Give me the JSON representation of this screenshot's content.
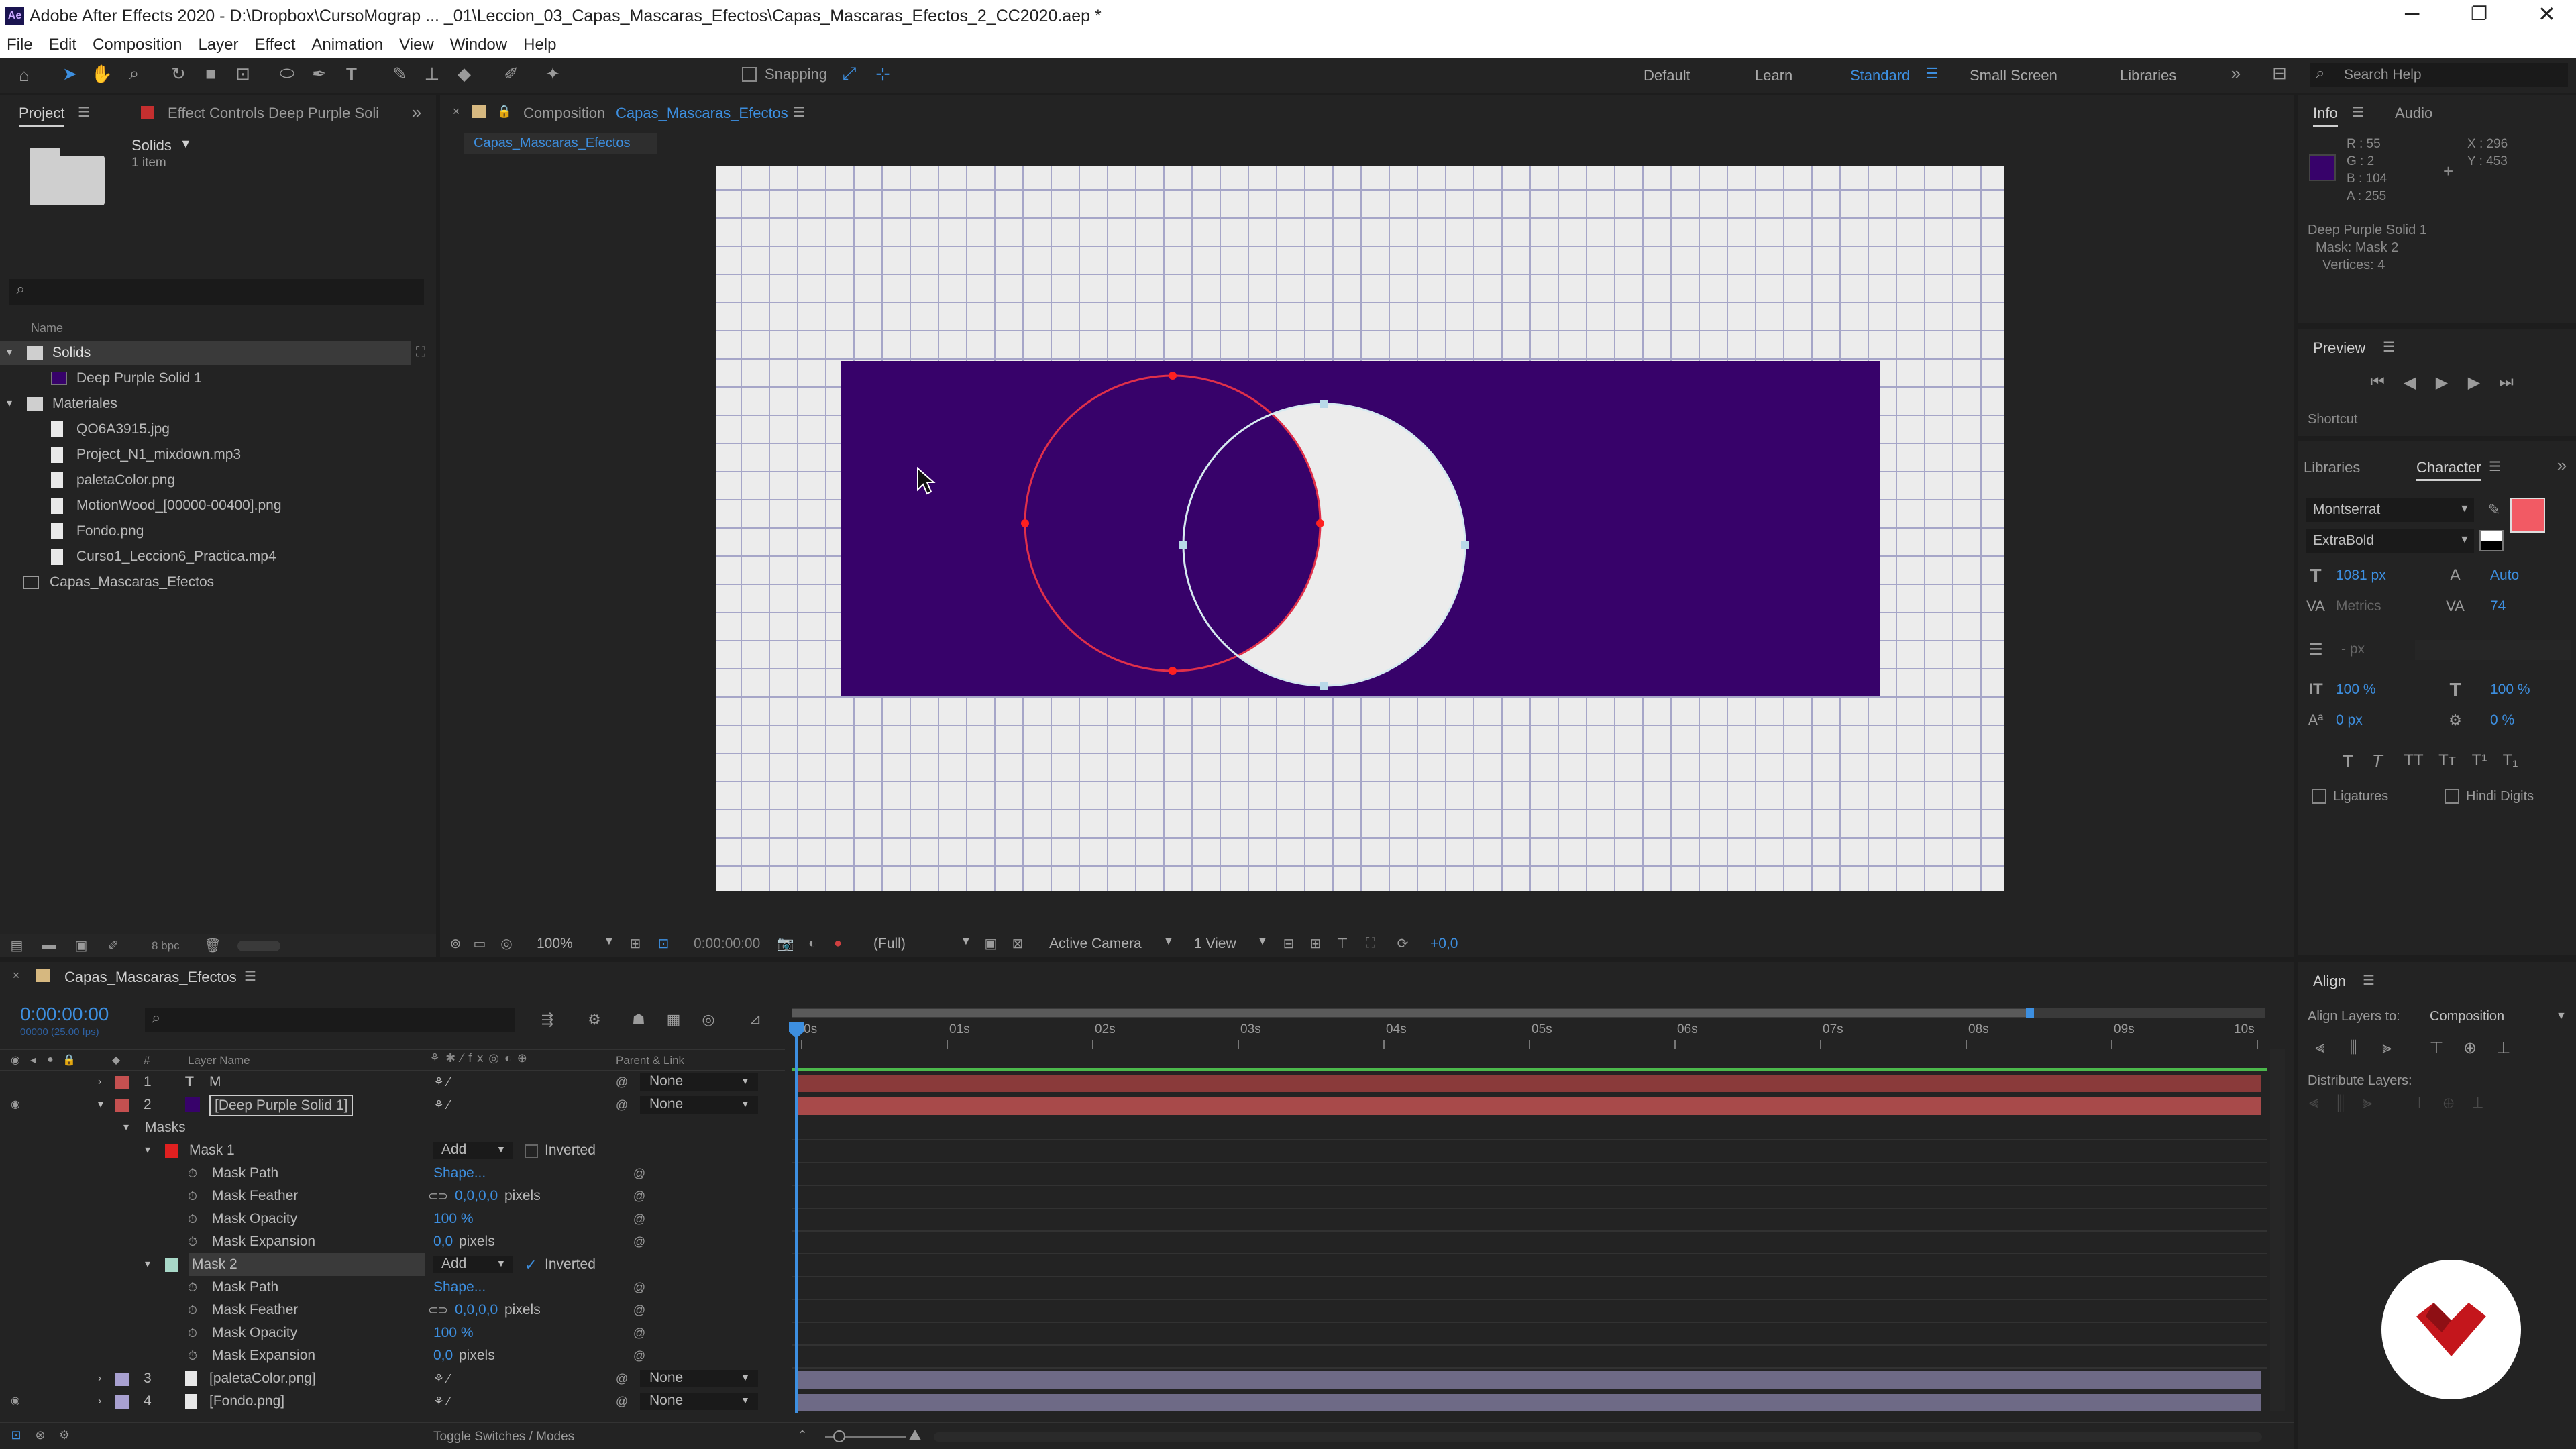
{
  "app": {
    "title": "Adobe After Effects 2020 - D:\\Dropbox\\CursoMograp ... _01\\Leccion_03_Capas_Mascaras_Efectos\\Capas_Mascaras_Efectos_2_CC2020.aep *"
  },
  "menu": [
    "File",
    "Edit",
    "Composition",
    "Layer",
    "Effect",
    "Animation",
    "View",
    "Window",
    "Help"
  ],
  "toolbar": {
    "snapping": "Snapping"
  },
  "workspaces": [
    "Default",
    "Learn",
    "Standard",
    "Small Screen",
    "Libraries"
  ],
  "search_help": "Search Help",
  "project": {
    "tab": "Project",
    "effect_controls_tab": "Effect Controls Deep Purple Soli",
    "selected_name": "Solids",
    "selected_count": "1 item",
    "column_name": "Name",
    "items": [
      {
        "label": "Solids",
        "type": "folder",
        "level": 0
      },
      {
        "label": "Deep Purple Solid 1",
        "type": "solid",
        "level": 1
      },
      {
        "label": "Materiales",
        "type": "folder",
        "level": 0
      },
      {
        "label": "QO6A3915.jpg",
        "type": "file",
        "level": 1
      },
      {
        "label": "Project_N1_mixdown.mp3",
        "type": "file",
        "level": 1
      },
      {
        "label": "paletaColor.png",
        "type": "file",
        "level": 1
      },
      {
        "label": "MotionWood_[00000-00400].png",
        "type": "file",
        "level": 1
      },
      {
        "label": "Fondo.png",
        "type": "file",
        "level": 1
      },
      {
        "label": "Curso1_Leccion6_Practica.mp4",
        "type": "file",
        "level": 1
      },
      {
        "label": "Capas_Mascaras_Efectos",
        "type": "comp",
        "level": 0
      }
    ],
    "bpc": "8 bpc"
  },
  "composition": {
    "tab_prefix": "Composition",
    "tab_name": "Capas_Mascaras_Efectos",
    "subtab": "Capas_Mascaras_Efectos",
    "zoom": "100%",
    "timecode": "0:00:00:00",
    "resolution": "(Full)",
    "camera": "Active Camera",
    "views": "1 View",
    "exposure": "+0,0"
  },
  "info": {
    "tab": "Info",
    "audio_tab": "Audio",
    "r": "R : 55",
    "g": "G : 2",
    "b": "B : 104",
    "a": "A : 255",
    "x": "X : 296",
    "y": "Y : 453",
    "layer": "Deep Purple Solid 1",
    "mask": "Mask: Mask 2",
    "vertices": "Vertices: 4",
    "swatch": "#37026a"
  },
  "preview": {
    "tab": "Preview",
    "shortcut": "Shortcut"
  },
  "character": {
    "libraries_tab": "Libraries",
    "tab": "Character",
    "font": "Montserrat",
    "style": "ExtraBold",
    "size": "1081 px",
    "leading": "Auto",
    "kerning": "Metrics",
    "tracking": "74",
    "stroke": "- px",
    "vscale": "100 %",
    "hscale": "100 %",
    "baseline": "0 px",
    "tsume": "0 %",
    "ligatures": "Ligatures",
    "hindi": "Hindi Digits",
    "fill_color": "#f25a64"
  },
  "align": {
    "tab": "Align",
    "align_to_label": "Align Layers to:",
    "align_to": "Composition",
    "distribute": "Distribute Layers:"
  },
  "timeline": {
    "tab": "Capas_Mascaras_Efectos",
    "timecode": "0:00:00:00",
    "frames": "00000 (25.00 fps)",
    "col_layer": "Layer Name",
    "col_num": "#",
    "col_parent": "Parent & Link",
    "ruler": [
      "0s",
      "01s",
      "02s",
      "03s",
      "04s",
      "05s",
      "06s",
      "07s",
      "08s",
      "09s",
      "10s"
    ],
    "layers": [
      {
        "num": "1",
        "name": "M",
        "label": "#c45050",
        "parent": "None",
        "bar": "#8a3a3a"
      },
      {
        "num": "2",
        "name": "[Deep Purple Solid 1]",
        "label": "#c45050",
        "parent": "None",
        "bar": "#a84a4a"
      },
      {
        "num": "3",
        "name": "[paletaColor.png]",
        "label": "#a8a0d0",
        "parent": "None",
        "bar": "#6e6a86"
      },
      {
        "num": "4",
        "name": "[Fondo.png]",
        "label": "#a8a0d0",
        "parent": "None",
        "bar": "#6e6a86"
      }
    ],
    "masks_label": "Masks",
    "masks": [
      {
        "name": "Mask 1",
        "mode": "Add",
        "inverted": "Inverted",
        "inverted_checked": false,
        "color": "#e02020",
        "props": [
          {
            "name": "Mask Path",
            "value": "Shape...",
            "unit": ""
          },
          {
            "name": "Mask Feather",
            "value": "0,0,0,0",
            "unit": "pixels"
          },
          {
            "name": "Mask Opacity",
            "value": "100 %",
            "unit": ""
          },
          {
            "name": "Mask Expansion",
            "value": "0,0",
            "unit": "pixels"
          }
        ]
      },
      {
        "name": "Mask 2",
        "mode": "Add",
        "inverted": "Inverted",
        "inverted_checked": true,
        "color": "#a8d8c8",
        "props": [
          {
            "name": "Mask Path",
            "value": "Shape...",
            "unit": ""
          },
          {
            "name": "Mask Feather",
            "value": "0,0,0,0",
            "unit": "pixels"
          },
          {
            "name": "Mask Opacity",
            "value": "100 %",
            "unit": ""
          },
          {
            "name": "Mask Expansion",
            "value": "0,0",
            "unit": "pixels"
          }
        ]
      }
    ],
    "toggle": "Toggle Switches / Modes"
  }
}
